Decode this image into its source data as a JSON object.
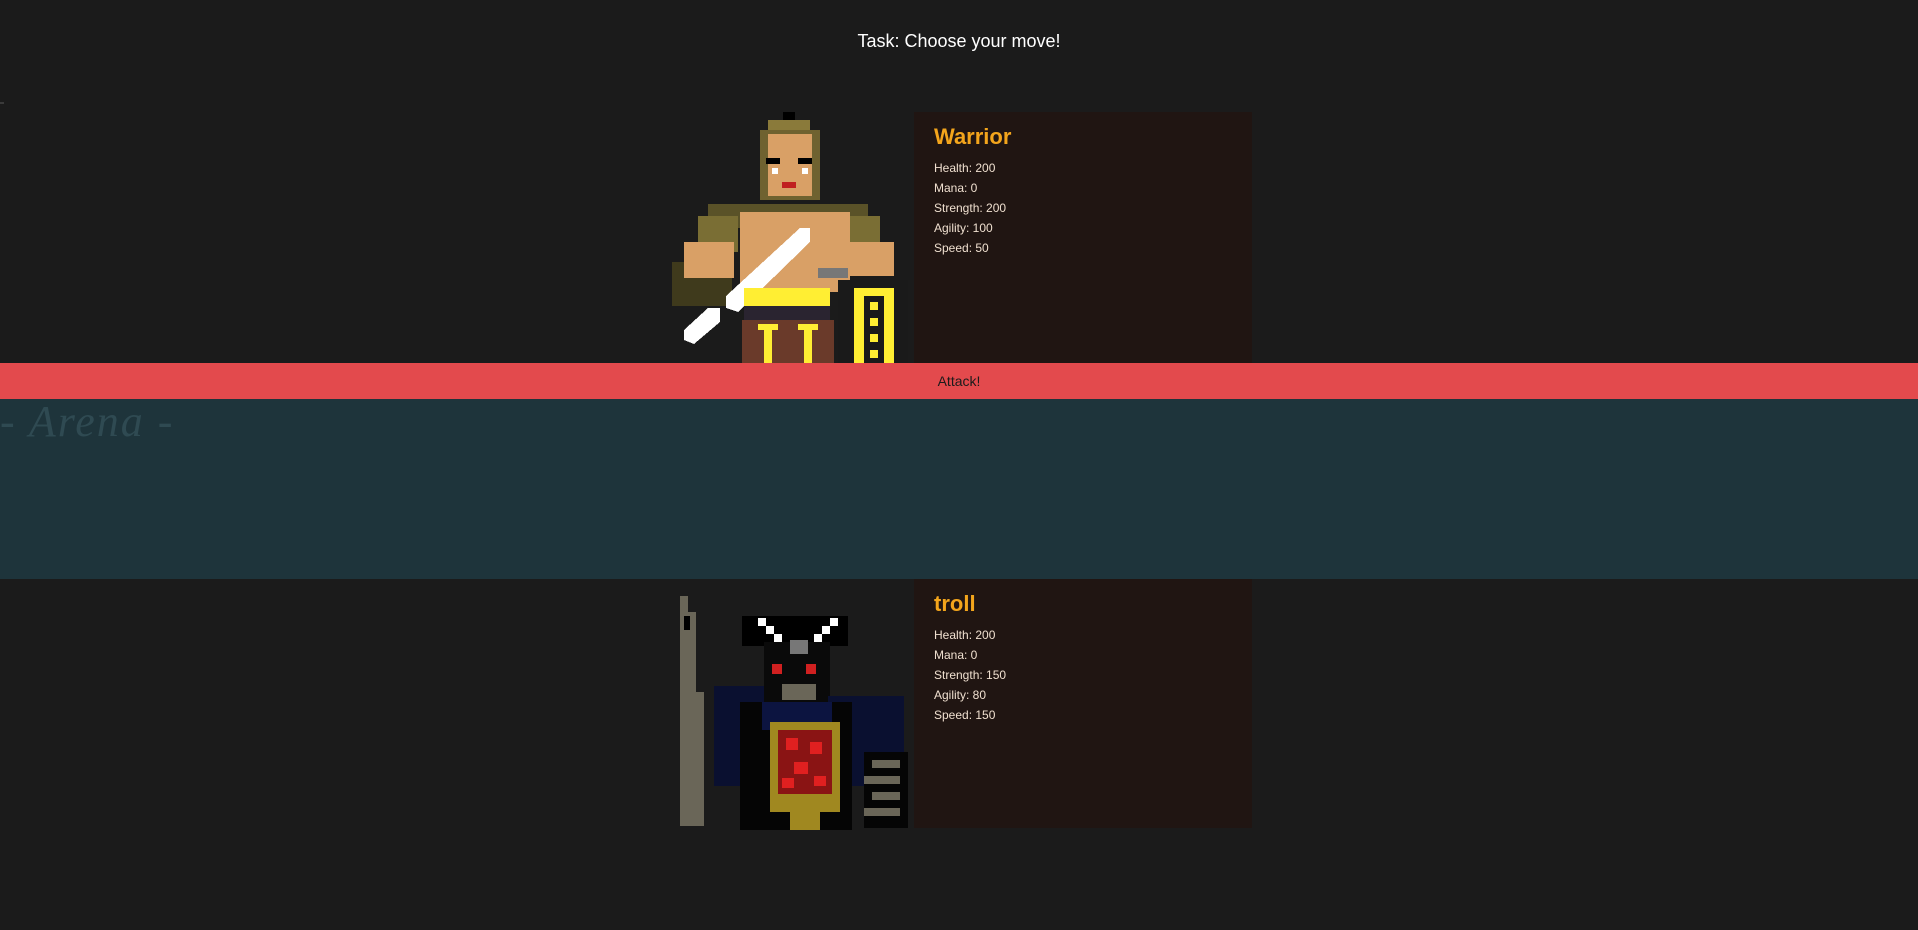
{
  "task": {
    "text": "Task: Choose your move!"
  },
  "player": {
    "name": "Warrior",
    "stats": [
      "Health: 200",
      "Mana: 0",
      "Strength: 200",
      "Agility: 100",
      "Speed: 50"
    ]
  },
  "enemy": {
    "name": "troll",
    "stats": [
      "Health: 200",
      "Mana: 0",
      "Strength: 150",
      "Agility: 80",
      "Speed: 150"
    ]
  },
  "attack_button": {
    "label": "Attack!"
  },
  "arena": {
    "title": "- Arena -"
  },
  "colors": {
    "background": "#1b1b1b",
    "stats_panel": "#201512",
    "name_accent": "#f3a51c",
    "attack_bar": "#e34a4d",
    "arena_band": "#1e343b"
  },
  "icons": {
    "player_sprite": "warrior-sprite-icon",
    "enemy_sprite": "troll-sprite-icon"
  }
}
